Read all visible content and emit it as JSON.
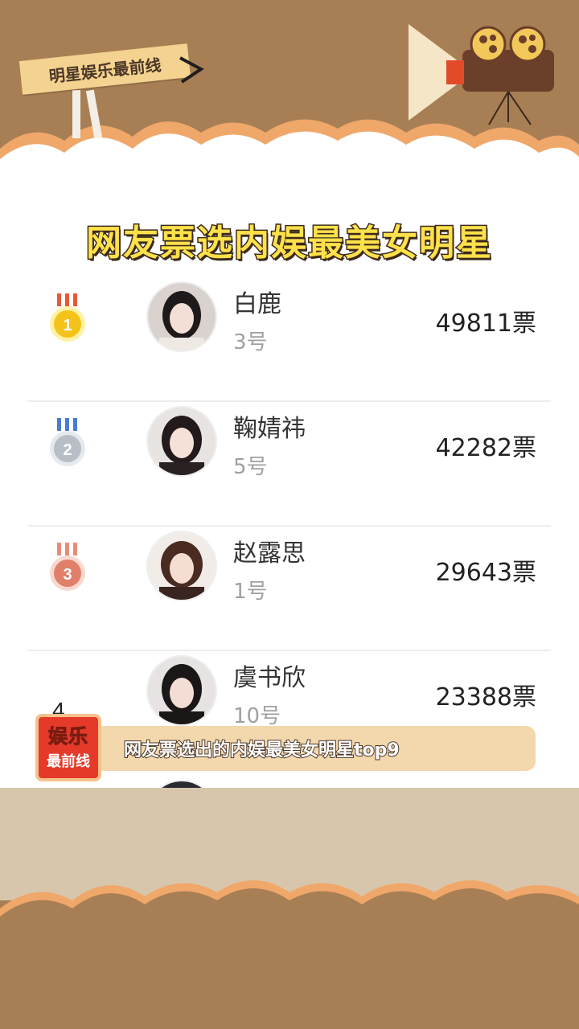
{
  "header": {
    "sign_label": "明星娱乐最前线",
    "title": "网友票选内娱最美女明星"
  },
  "ranking": [
    {
      "rank": "1",
      "medal": "gold",
      "name": "白鹿",
      "number": "3号",
      "votes": "49811票"
    },
    {
      "rank": "2",
      "medal": "silver",
      "name": "鞠婧祎",
      "number": "5号",
      "votes": "42282票"
    },
    {
      "rank": "3",
      "medal": "bronze",
      "name": "赵露思",
      "number": "1号",
      "votes": "29643票"
    },
    {
      "rank": "4",
      "medal": "none",
      "name": "虞书欣",
      "number": "10号",
      "votes": "23388票"
    }
  ],
  "caption": {
    "logo_line1": "娱乐",
    "logo_line2": "最前线",
    "text": "网友票选出的内娱最美女明星top9"
  },
  "colors": {
    "brown": "#a87f54",
    "cream": "#d8c6ac",
    "title_yellow": "#ffe14a",
    "caption_bg": "#f3d7ad",
    "gold": "#f5c21a",
    "silver": "#b9bec6",
    "bronze": "#e0806a"
  }
}
